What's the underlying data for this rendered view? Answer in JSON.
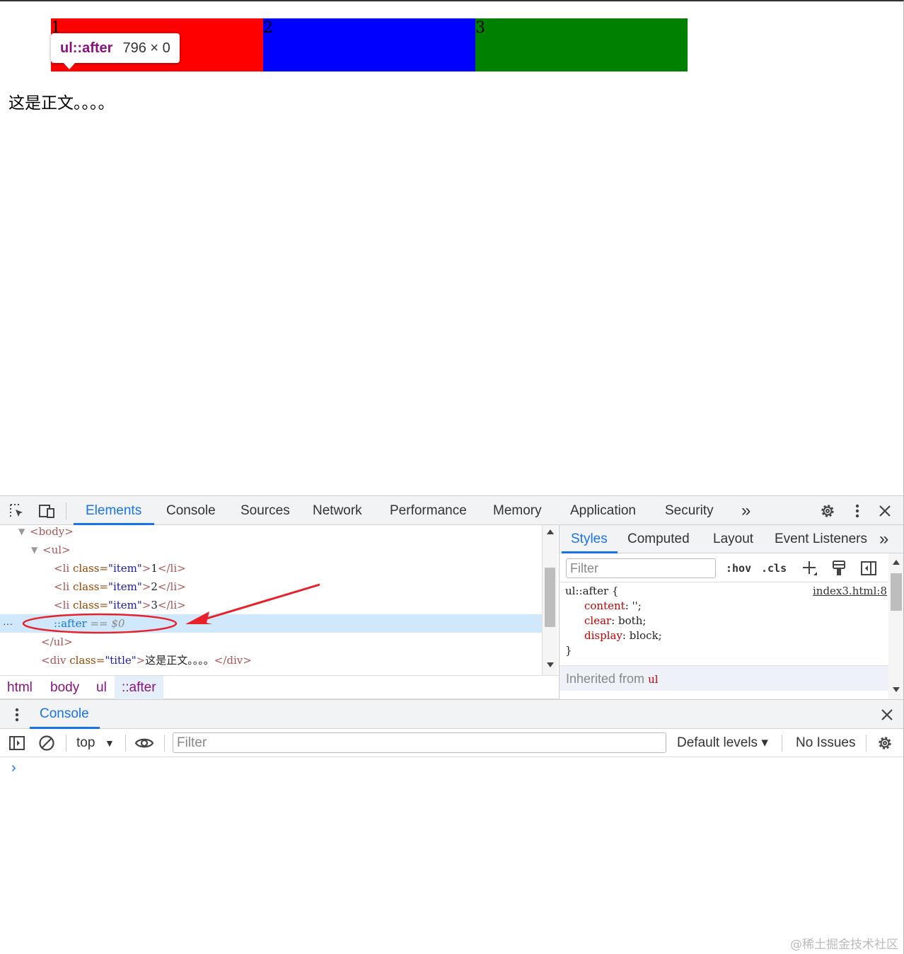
{
  "page": {
    "items": [
      "1",
      "2",
      "3"
    ],
    "item_colors": [
      "#ff0000",
      "#0000ff",
      "#008000"
    ],
    "body_text": "这是正文。。。。",
    "tooltip": {
      "selector": "ul::after",
      "size": "796 × 0"
    }
  },
  "devtools": {
    "toolbar": {
      "icons": [
        "inspect-element-icon",
        "device-toolbar-icon"
      ],
      "tabs": [
        "Elements",
        "Console",
        "Sources",
        "Network",
        "Performance",
        "Memory",
        "Application",
        "Security"
      ],
      "active_tab": "Elements",
      "more_tabs_glyph": "»",
      "right_icons": [
        "settings-gear-icon",
        "more-vert-icon",
        "close-icon"
      ]
    },
    "dom": {
      "body_tag": "<body>",
      "ul_tag": "<ul>",
      "li_open": "<li ",
      "li_attr": "class=",
      "li_val": "\"item\"",
      "li_items": [
        "1",
        "2",
        "3"
      ],
      "li_close": "</li>",
      "after": "::after",
      "after_ref": "== $0",
      "ul_close": "</ul>",
      "div_open": "<div ",
      "div_attr": "class=",
      "div_val": "\"title\"",
      "div_text": "这是正文。。。。",
      "div_close": "</div>",
      "dots": "···"
    },
    "breadcrumb": [
      "html",
      "body",
      "ul",
      "::after"
    ],
    "styles": {
      "tabs": [
        "Styles",
        "Computed",
        "Layout",
        "Event Listeners"
      ],
      "active_tab": "Styles",
      "filter_placeholder": "Filter",
      "hov": ":hov",
      "cls": ".cls",
      "selector": "ul::after {",
      "source": "index3.html:8",
      "props": [
        {
          "name": "content",
          "value": "'';"
        },
        {
          "name": "clear",
          "value": "both;"
        },
        {
          "name": "display",
          "value": "block;"
        }
      ],
      "close_brace": "}",
      "inherited_label": "Inherited from",
      "inherited_tag": "ul"
    },
    "console": {
      "tab": "Console",
      "context": "top",
      "filter_placeholder": "Filter",
      "levels": "Default levels ▾",
      "issues": "No Issues",
      "prompt": "›"
    },
    "accent_color": "#1a73e8"
  },
  "watermark": "@稀土掘金技术社区"
}
